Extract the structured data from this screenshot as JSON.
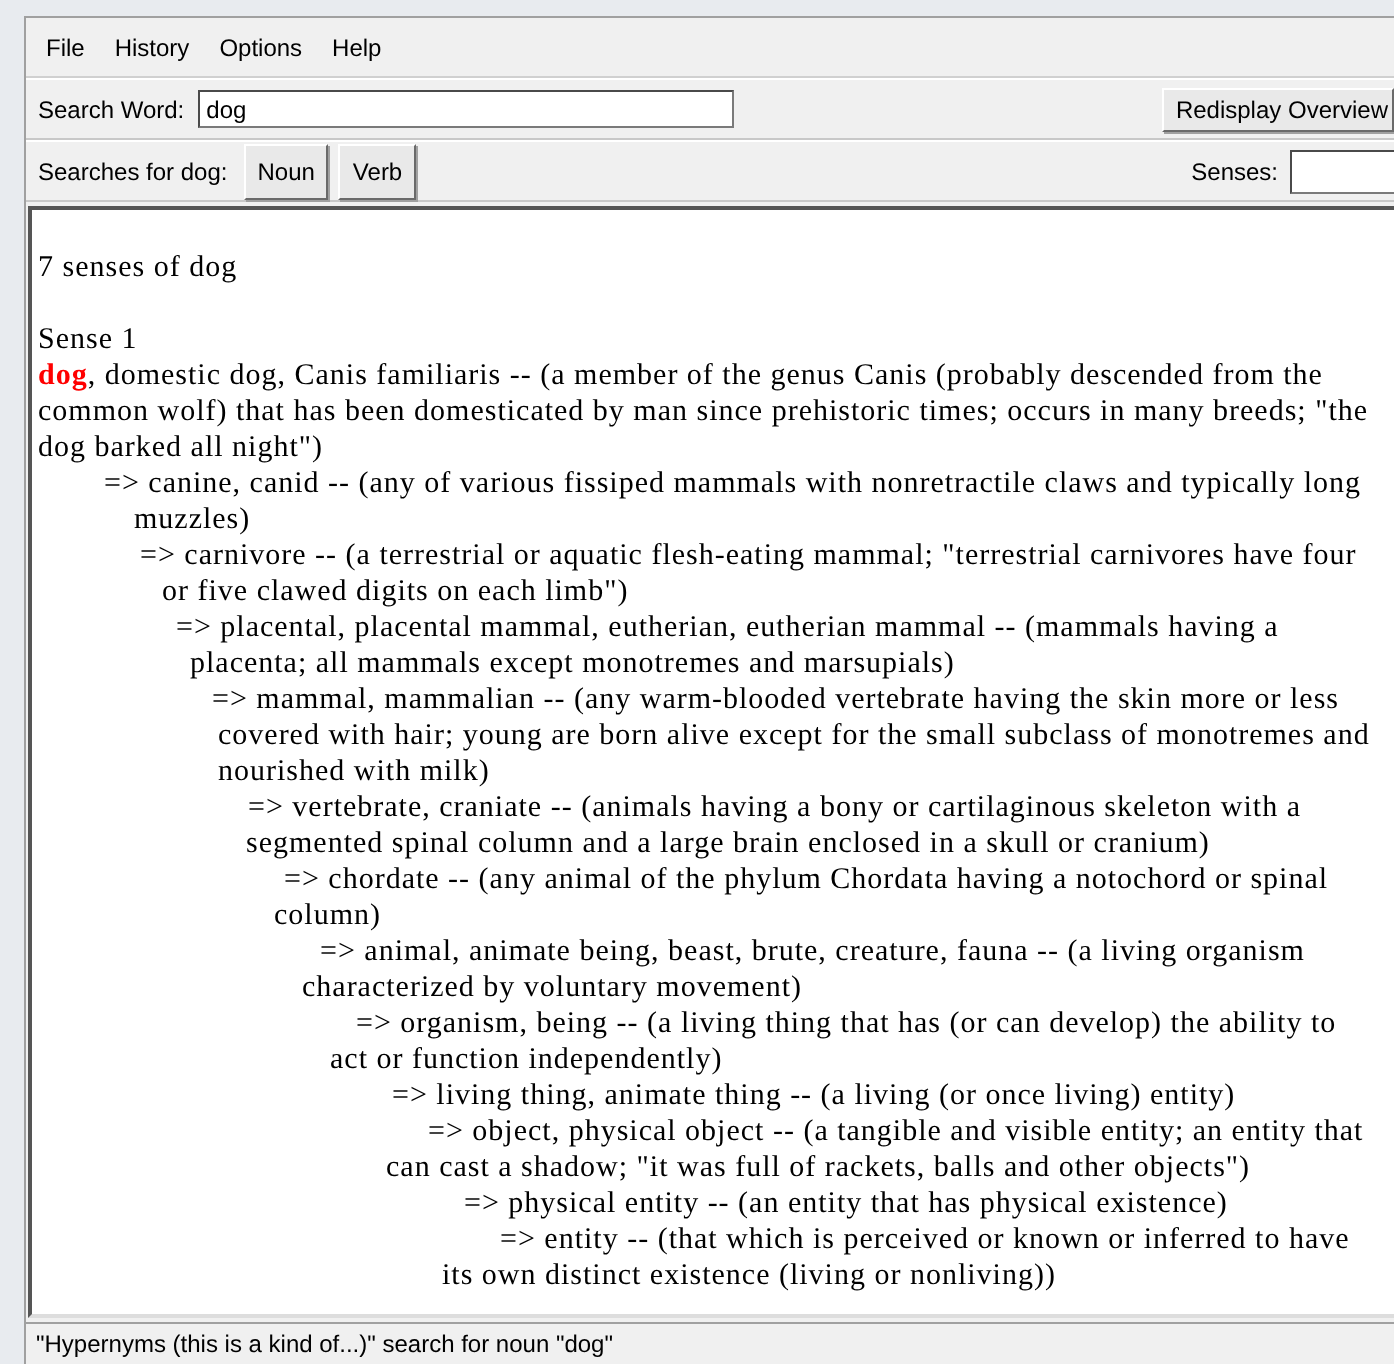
{
  "menu": [
    {
      "label": "File"
    },
    {
      "label": "History"
    },
    {
      "label": "Options"
    },
    {
      "label": "Help"
    }
  ],
  "search": {
    "label": "Search Word:",
    "value": "dog",
    "button": "Redisplay Overview"
  },
  "searches": {
    "label": "Searches for dog:",
    "buttons": [
      "Noun",
      "Verb"
    ],
    "senses_label": "Senses:"
  },
  "results": {
    "summary": "7 senses of dog",
    "senses": [
      {
        "heading": "Sense 1",
        "synonyms": "**dog**, domestic dog, Canis familiaris -- (a member of the genus Canis (probably descended from the common wolf) that has been domesticated by man since prehistoric times; occurs in many breeds; \"the dog barked all night\")",
        "hypernyms": [
          {
            "text": "=> canine, canid -- (any of various fissiped mammals with nonretractile claws and typically long muzzles)",
            "children": [
              {
                "text": "=> carnivore -- (a terrestrial or aquatic flesh-eating mammal; \"terrestrial carnivores have four or five clawed digits on each limb\")",
                "children": [
                  {
                    "text": "=> placental, placental mammal, eutherian, eutherian mammal -- (mammals having a placenta; all mammals except monotremes and marsupials)",
                    "children": [
                      {
                        "text": "=> mammal, mammalian -- (any warm-blooded vertebrate having the skin more or less covered with hair; young are born alive except for the small subclass of monotremes and nourished with milk)",
                        "children": [
                          {
                            "text": "=> vertebrate, craniate -- (animals having a bony or cartilaginous skeleton with a segmented spinal column and a large brain enclosed in a skull or cranium)",
                            "children": [
                              {
                                "text": "=> chordate -- (any animal of the phylum Chordata having a notochord or spinal column)",
                                "children": [
                                  {
                                    "text": "=> animal, animate being, beast, brute, creature, fauna -- (a living organism characterized by voluntary movement)",
                                    "children": [
                                      {
                                        "text": "=> organism, being -- (a living thing that has (or can develop) the ability to act or function independently)",
                                        "children": [
                                          {
                                            "text": "=> living thing, animate thing -- (a living (or once living) entity)",
                                            "children": [
                                              {
                                                "text": "=> object, physical object -- (a tangible and visible entity; an entity that can cast a shadow; \"it was full of rackets, balls and other objects\")",
                                                "children": [
                                                  {
                                                    "text": "=> physical entity -- (an entity that has physical existence)",
                                                    "children": [
                                                      {
                                                        "text": "=> entity -- (that which is perceived or known or inferred to have its own distinct existence (living or nonliving))"
                                                      }
                                                    ]
                                                  }
                                                ]
                                              }
                                            ]
                                          }
                                        ]
                                      }
                                    ]
                                  }
                                ]
                              }
                            ]
                          }
                        ]
                      }
                    ]
                  }
                ]
              }
            ]
          }
        ]
      }
    ]
  },
  "status_bar": "\"Hypernyms (this is a kind of...)\" search for noun \"dog\""
}
